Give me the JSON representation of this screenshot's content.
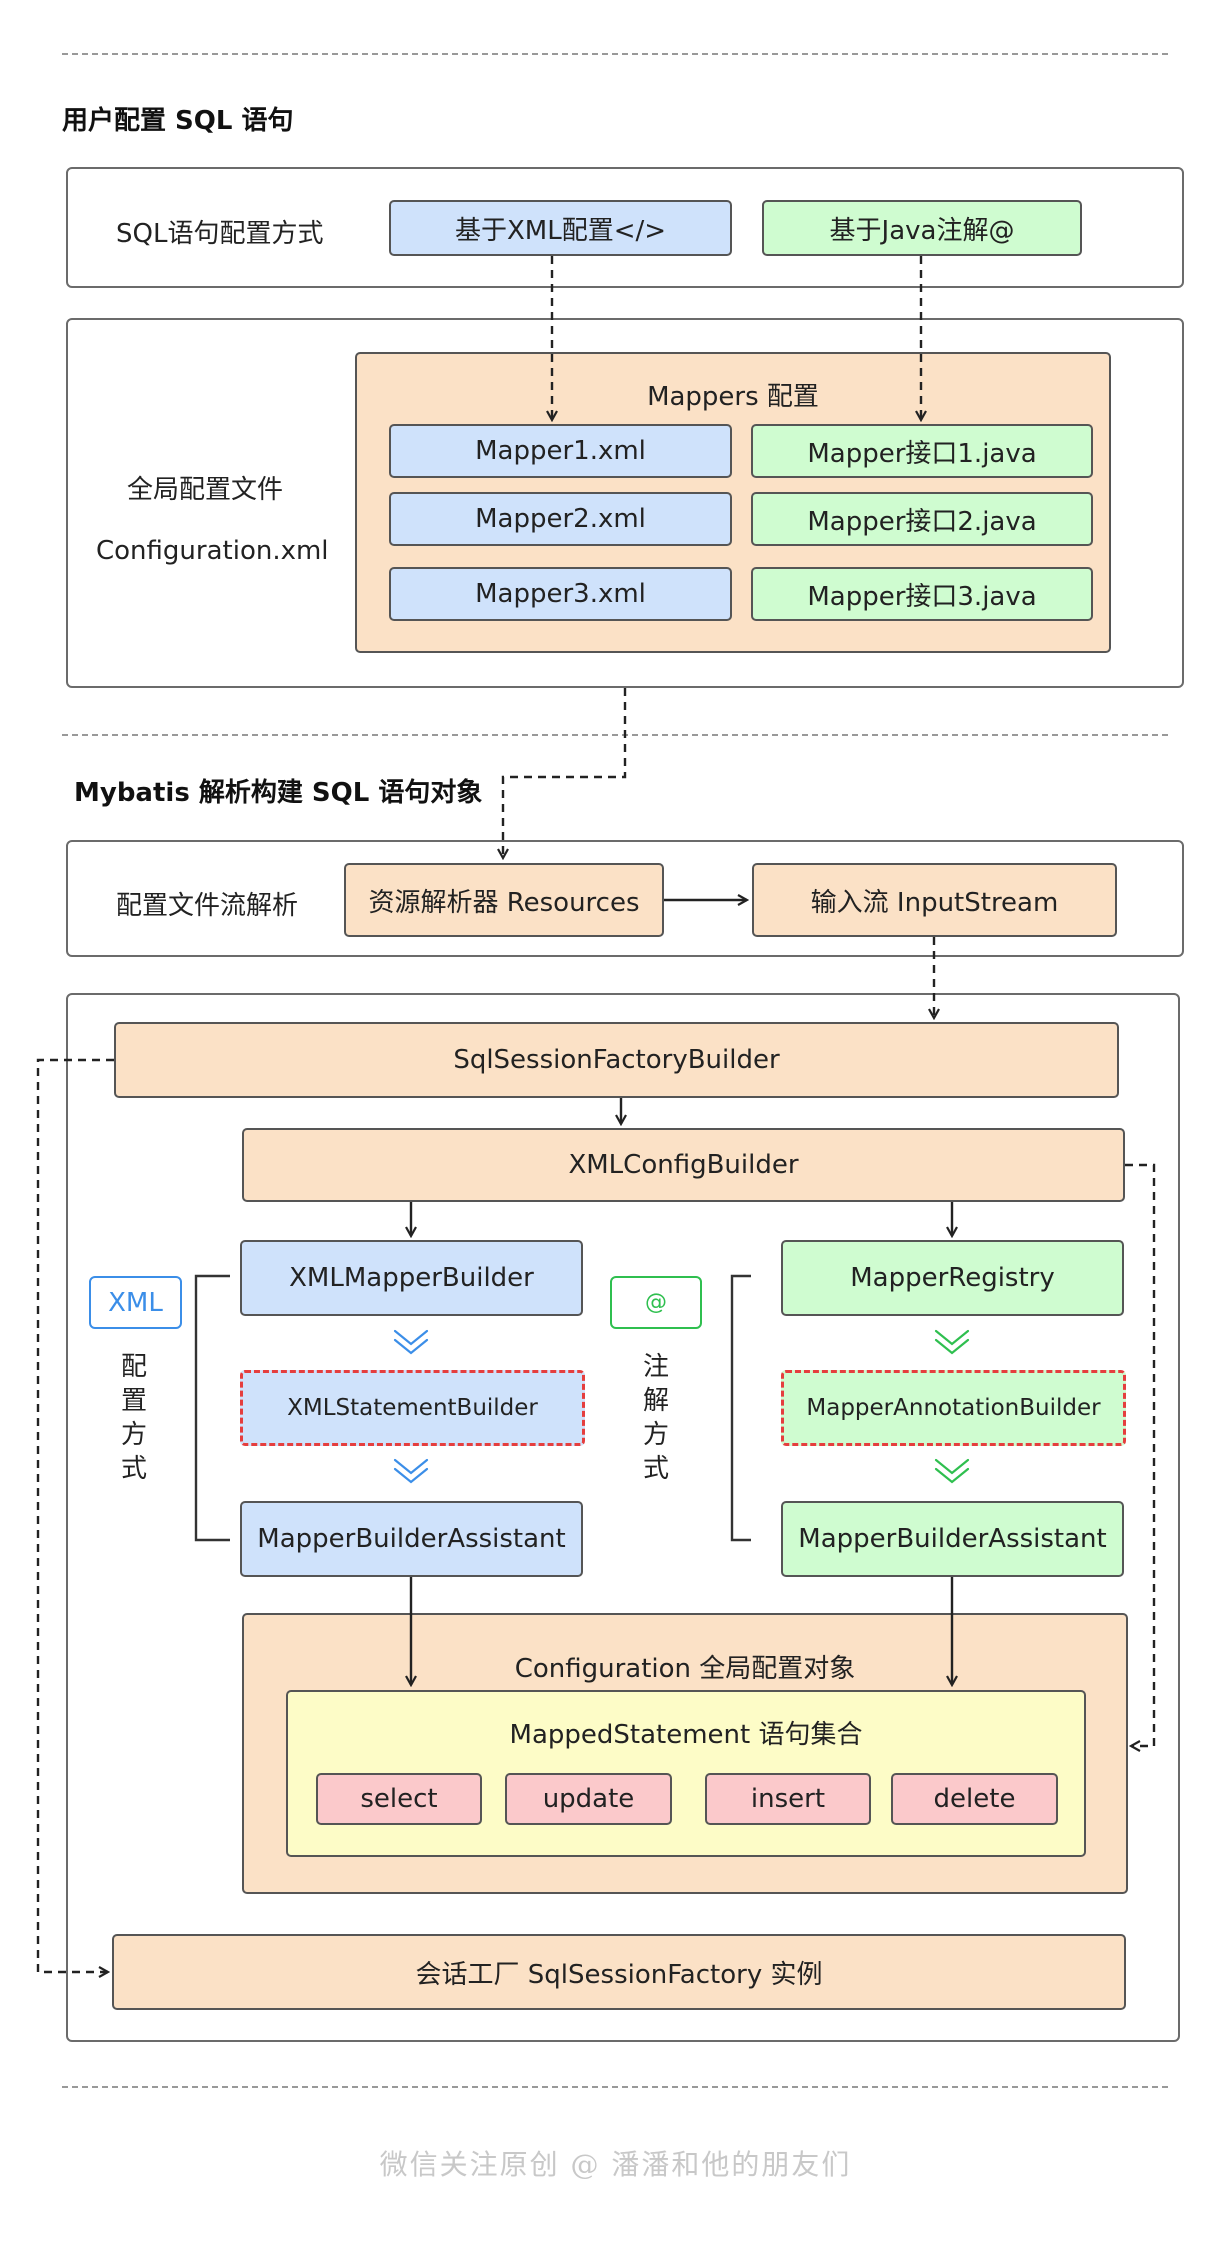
{
  "section1": {
    "title": "用户配置 SQL 语句"
  },
  "row_sql": {
    "label": "SQL语句配置方式",
    "xml_box": "基于XML配置</>",
    "java_box": "基于Java注解@"
  },
  "global_config": {
    "label_line1": "全局配置文件",
    "label_line2": "Configuration.xml",
    "mappers_title": "Mappers 配置",
    "xml_mappers": [
      "Mapper1.xml",
      "Mapper2.xml",
      "Mapper3.xml"
    ],
    "java_mappers": [
      "Mapper接口1.java",
      "Mapper接口2.java",
      "Mapper接口3.java"
    ]
  },
  "section2": {
    "title": "Mybatis 解析构建 SQL 语句对象"
  },
  "stream_row": {
    "label": "配置文件流解析",
    "resources": "资源解析器 Resources",
    "inputstream": "输入流 InputStream"
  },
  "builder": {
    "factory_builder": "SqlSessionFactoryBuilder",
    "xml_config_builder": "XMLConfigBuilder",
    "xml_tag": "XML",
    "xml_side_label": [
      "配",
      "置",
      "方",
      "式"
    ],
    "xml_mapper_builder": "XMLMapperBuilder",
    "xml_statement_builder": "XMLStatementBuilder",
    "mapper_builder_assistant_left": "MapperBuilderAssistant",
    "anno_tag": "@",
    "anno_side_label": [
      "注",
      "解",
      "方",
      "式"
    ],
    "mapper_registry": "MapperRegistry",
    "mapper_annotation_builder": "MapperAnnotationBuilder",
    "mapper_builder_assistant_right": "MapperBuilderAssistant",
    "configuration_title": "Configuration 全局配置对象",
    "mapped_statement_title": "MappedStatement 语句集合",
    "statements": [
      "select",
      "update",
      "insert",
      "delete"
    ],
    "session_factory": "会话工厂 SqlSessionFactory 实例"
  },
  "footer": "微信关注原创 @ 潘潘和他的朋友们",
  "colors": {
    "xml_blue": "#cfe2fb",
    "annotation_green": "#cffcd0",
    "process_peach": "#fbe1c6",
    "statement_yellow": "#fdfcc7",
    "statement_pink": "#fbc9cb",
    "highlight_red": "#e53e3e",
    "xml_tag_blue": "#3b8ee8",
    "anno_tag_green": "#2fbf4f"
  }
}
